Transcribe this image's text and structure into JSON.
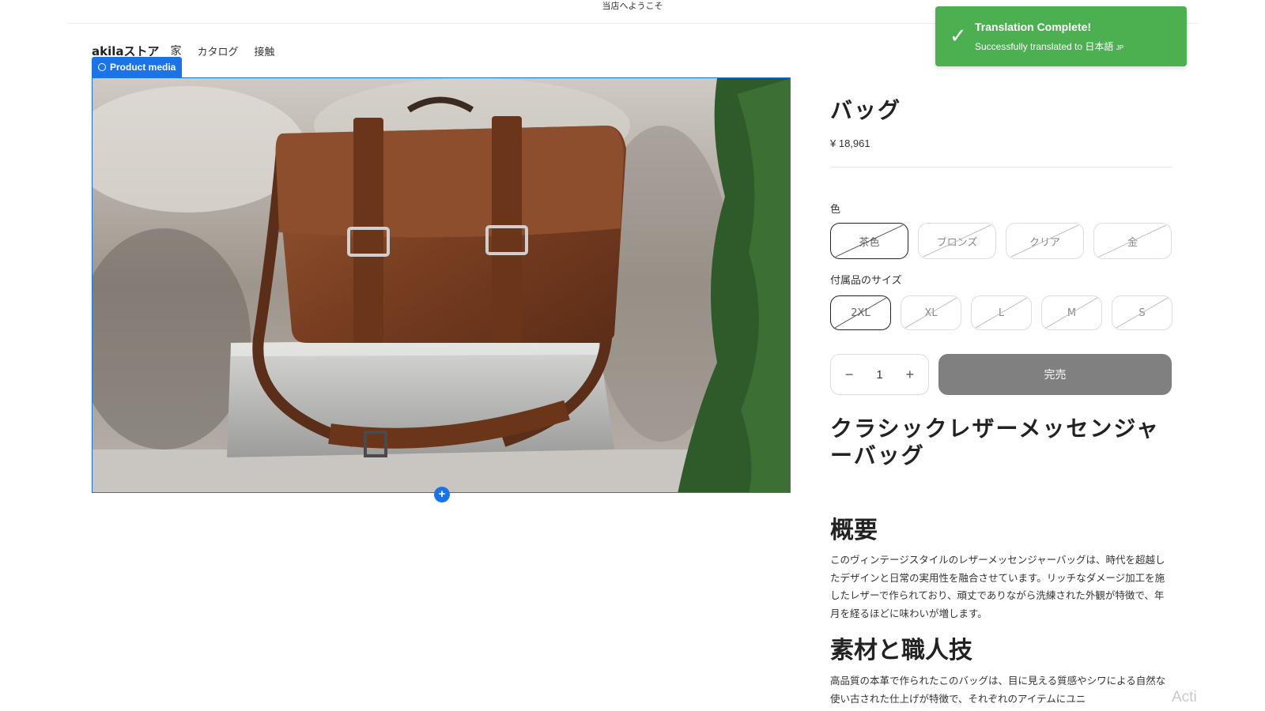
{
  "announcement": "当店へようこそ",
  "header": {
    "store_name": "akilaストア",
    "nav": [
      "家",
      "カタログ",
      "接触"
    ]
  },
  "editor": {
    "media_tag": "Product media",
    "add_icon": "plus-icon",
    "accent_color": "#1a73e8"
  },
  "toast": {
    "icon": "check-icon",
    "title": "Translation Complete!",
    "message": "Successfully translated to 日本語",
    "flag": "JP",
    "color": "#4caf50"
  },
  "product": {
    "title": "バッグ",
    "price": "¥ 18,961",
    "color_label": "色",
    "colors": [
      {
        "label": "茶色",
        "selected": true
      },
      {
        "label": "ブロンズ",
        "selected": false
      },
      {
        "label": "クリア",
        "selected": false
      },
      {
        "label": "金",
        "selected": false
      }
    ],
    "size_label": "付属品のサイズ",
    "sizes": [
      {
        "label": "2XL",
        "selected": true
      },
      {
        "label": "XL",
        "selected": false
      },
      {
        "label": "L",
        "selected": false
      },
      {
        "label": "M",
        "selected": false
      },
      {
        "label": "S",
        "selected": false
      }
    ],
    "quantity": "1",
    "qty_minus": "−",
    "qty_plus": "+",
    "sold_out_label": "完売",
    "subtitle": "クラシックレザーメッセンジャーバッグ",
    "overview_heading": "概要",
    "overview_text": "このヴィンテージスタイルのレザーメッセンジャーバッグは、時代を超越したデザインと日常の実用性を融合させています。リッチなダメージ加工を施したレザーで作られており、頑丈でありながら洗練された外観が特徴で、年月を経るほどに味わいが増します。",
    "material_heading": "素材と職人技",
    "material_text": "高品質の本革で作られたこのバッグは、目に見える質感やシワによる自然な使い古された仕上げが特徴で、それぞれのアイテムにユニ"
  },
  "watermark": "Acti"
}
